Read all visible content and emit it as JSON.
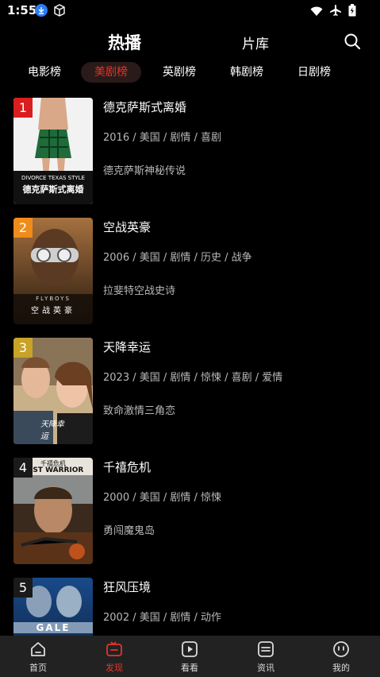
{
  "status": {
    "time": "1:55"
  },
  "header": {
    "tab_hot": "热播",
    "tab_library": "片库"
  },
  "categories": [
    "电影榜",
    "美剧榜",
    "英剧榜",
    "韩剧榜",
    "日剧榜"
  ],
  "active_category": "美剧榜",
  "items": [
    {
      "rank": "1",
      "title": "德克萨斯式离婚",
      "meta": "2016 / 美国 / 剧情 / 喜剧",
      "desc": "德克萨斯神秘传说",
      "poster_text": "DIVORCE TEXAS STYLE",
      "poster_cn": "德克萨斯式离婚",
      "rank_color": "#d81e1e"
    },
    {
      "rank": "2",
      "title": "空战英豪",
      "meta": "2006 / 美国 / 剧情 / 历史 / 战争",
      "desc": "拉斐特空战史诗",
      "poster_text": "FLYBOYS",
      "poster_cn": "空战英豪",
      "rank_color": "#f08c1a"
    },
    {
      "rank": "3",
      "title": "天降幸运",
      "meta": "2023 / 美国 / 剧情 / 惊悚 / 喜剧 / 爱情",
      "desc": "致命激情三角恋",
      "poster_text": "",
      "poster_cn": "天降幸运",
      "rank_color": "#c9a227"
    },
    {
      "rank": "4",
      "title": "千禧危机",
      "meta": "2000 / 美国 / 剧情 / 惊悚",
      "desc": "勇闯魔鬼岛",
      "poster_text": "LAST WARRIOR",
      "poster_cn": "千禧危机",
      "rank_color": "#1a1a1a"
    },
    {
      "rank": "5",
      "title": "狂风压境",
      "meta": "2002 / 美国 / 剧情 / 动作",
      "desc": "",
      "poster_text": "GALE",
      "poster_cn": "",
      "rank_color": "#1a1a1a"
    }
  ],
  "nav": [
    {
      "label": "首页",
      "icon": "home-icon"
    },
    {
      "label": "发现",
      "icon": "video-icon"
    },
    {
      "label": "看看",
      "icon": "play-icon"
    },
    {
      "label": "资讯",
      "icon": "news-icon"
    },
    {
      "label": "我的",
      "icon": "profile-icon"
    }
  ],
  "colors": {
    "accent": "#e5342b",
    "background": "#000000",
    "nav_bg": "#222222"
  }
}
